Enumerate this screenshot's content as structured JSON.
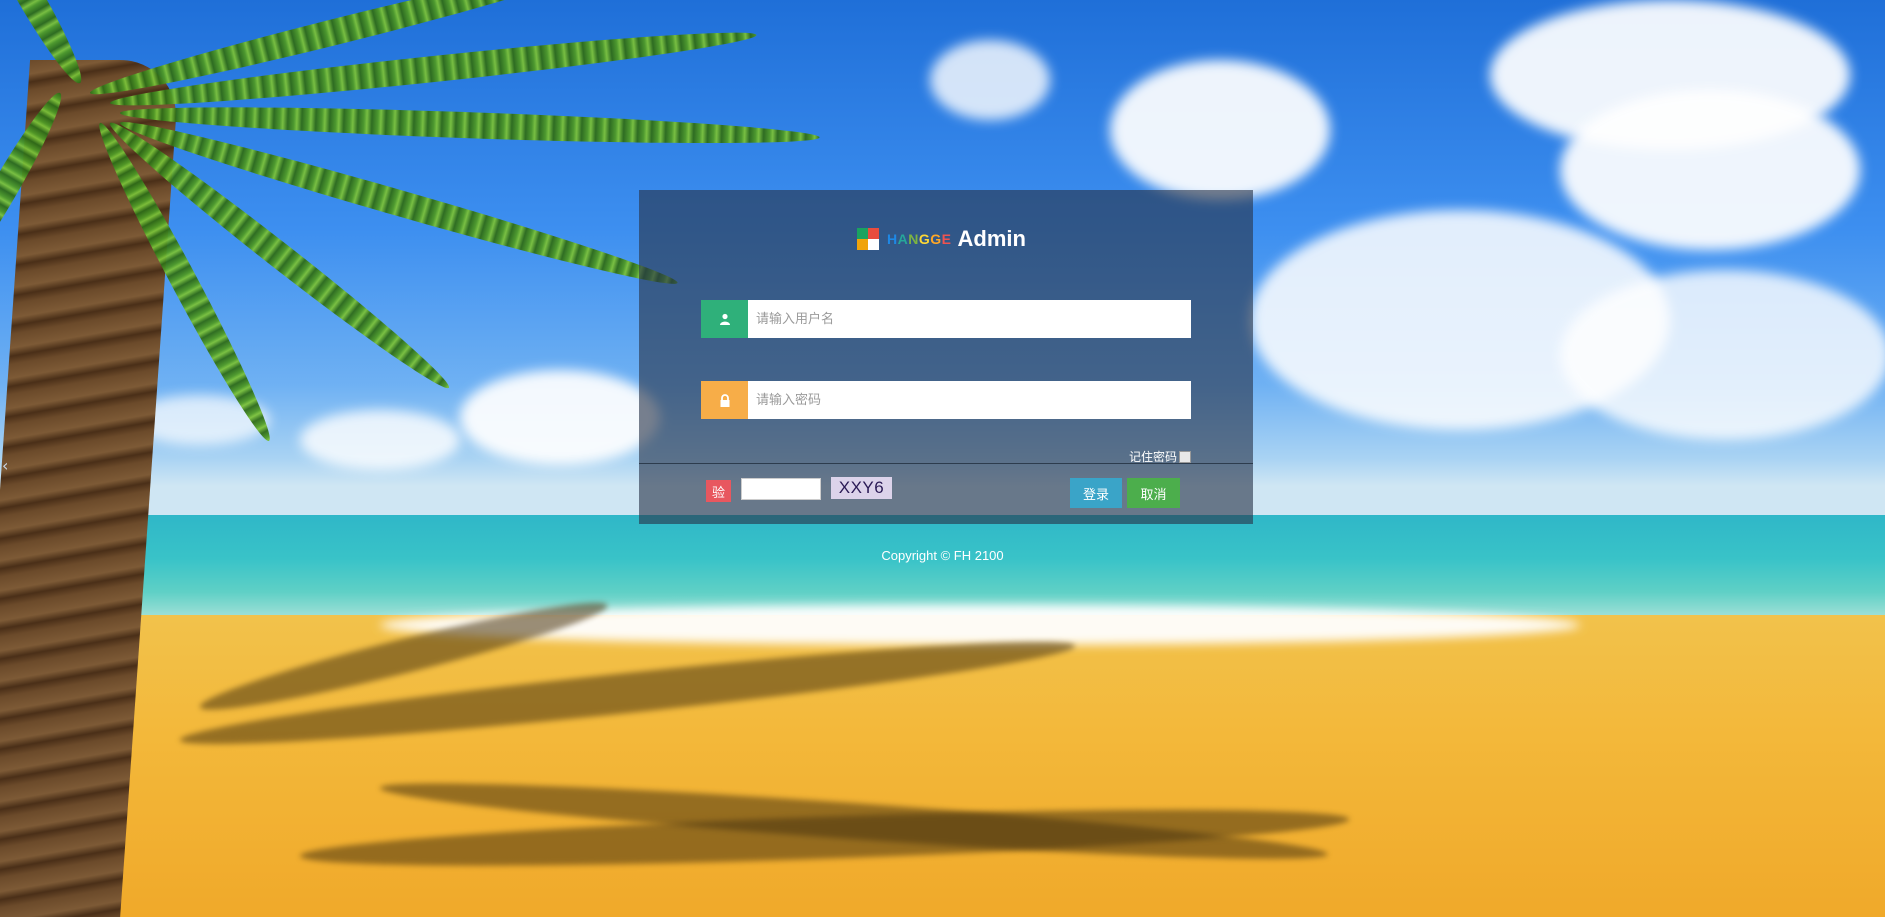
{
  "brand": {
    "logo_colors": [
      "#1aa260",
      "#e84c3d",
      "#f0a30a",
      "#ffffff"
    ],
    "hangge_letters": [
      {
        "ch": "H",
        "color": "#1e88e5"
      },
      {
        "ch": "A",
        "color": "#26a69a"
      },
      {
        "ch": "N",
        "color": "#7cb342"
      },
      {
        "ch": "G",
        "color": "#fdd835"
      },
      {
        "ch": "G",
        "color": "#ffa726"
      },
      {
        "ch": "E",
        "color": "#ef5350"
      }
    ],
    "admin": "Admin"
  },
  "form": {
    "username_placeholder": "请输入用户名",
    "username_icon": "user-icon",
    "username_icon_color": "#2fb07a",
    "password_placeholder": "请输入密码",
    "password_icon": "lock-icon",
    "password_icon_color": "#f7ad48",
    "remember_label": "记住密码",
    "verify_label": "验",
    "captcha_text": "XXY6",
    "login_label": "登录",
    "cancel_label": "取消"
  },
  "footer": {
    "copyright": "Copyright © FH 2100"
  }
}
